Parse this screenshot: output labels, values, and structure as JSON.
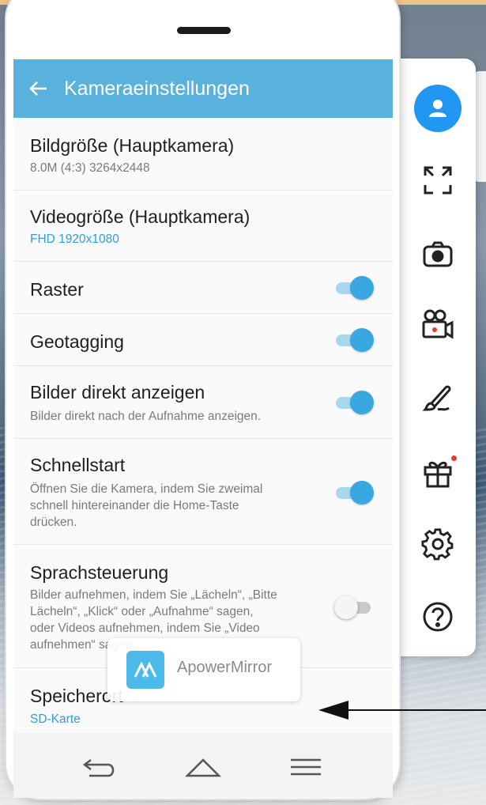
{
  "header": {
    "title": "Kameraeinstellungen"
  },
  "settings": [
    {
      "title": "Bildgröße (Hauptkamera)",
      "subtitle": "8.0M (4:3) 3264x2448"
    },
    {
      "title": "Videogröße (Hauptkamera)",
      "subtitle": "FHD 1920x1080"
    },
    {
      "title": "Raster",
      "toggle": true
    },
    {
      "title": "Geotagging",
      "toggle": true
    },
    {
      "title": "Bilder direkt anzeigen",
      "subtitle": "Bilder direkt nach der Aufnahme anzeigen.",
      "toggle": true
    },
    {
      "title": "Schnellstart",
      "subtitle_lines": [
        "Öffnen Sie die Kamera, indem Sie zweimal",
        "schnell hintereinander die Home-Taste",
        "drücken."
      ],
      "toggle": true
    },
    {
      "title": "Sprachsteuerung",
      "subtitle_lines": [
        "Bilder aufnehmen, indem Sie „Lächeln“, „Bitte",
        "Lächeln“, „Klick“ oder „Aufnahme“ sagen,",
        "oder Videos aufnehmen, indem Sie „Video",
        "aufnehmen“ sagen."
      ],
      "toggle": false
    },
    {
      "title": "Speicherort",
      "subtitle": "SD-Karte"
    }
  ],
  "toast": {
    "label": "ApowerMirror"
  },
  "side_panel": {
    "icons": [
      "user-icon",
      "fullscreen-icon",
      "screenshot-camera-icon",
      "screen-record-icon",
      "draw-brush-icon",
      "gift-icon",
      "settings-gear-icon",
      "help-icon"
    ]
  },
  "colors": {
    "accent": "#58b2dd",
    "toggle_on": "#3aa8e0",
    "side_user": "#2196f3",
    "badge": "#e53935"
  }
}
